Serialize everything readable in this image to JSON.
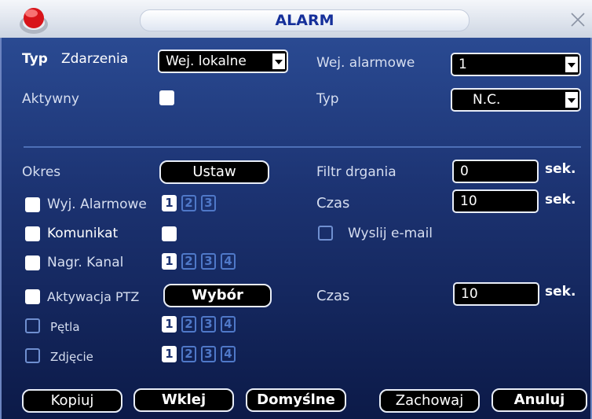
{
  "window": {
    "title": "ALARM"
  },
  "top": {
    "typ_label": "Typ",
    "zdarzenia_label": "Zdarzenia",
    "zdarzenia_value": "Wej. lokalne",
    "aktywny_label": "Aktywny",
    "wej_alarmowe_label": "Wej. alarmowe",
    "wej_alarmowe_value": "1",
    "typ2_label": "Typ",
    "typ2_value": "N.C."
  },
  "main": {
    "okres_label": "Okres",
    "ustaw_button": "Ustaw",
    "wyj_alarmowe_label": "Wyj. Alarmowe",
    "wyj_alarmowe_channels": [
      {
        "label": "1",
        "selected": true
      },
      {
        "label": "2",
        "selected": false
      },
      {
        "label": "3",
        "selected": false
      }
    ],
    "komunikat_label": "Komunikat",
    "nagr_kanal_label": "Nagr. Kanal",
    "nagr_kanal_channels": [
      {
        "label": "1",
        "selected": true
      },
      {
        "label": "2",
        "selected": false
      },
      {
        "label": "3",
        "selected": false
      },
      {
        "label": "4",
        "selected": false
      }
    ],
    "aktywacja_ptz_label": "Aktywacja PTZ",
    "wybor_button": "Wybór",
    "petla_label": "Pętla",
    "petla_channels": [
      {
        "label": "1",
        "selected": true
      },
      {
        "label": "2",
        "selected": false
      },
      {
        "label": "3",
        "selected": false
      },
      {
        "label": "4",
        "selected": false
      }
    ],
    "zdjecie_label": "Zdjęcie",
    "zdjecie_channels": [
      {
        "label": "1",
        "selected": true
      },
      {
        "label": "2",
        "selected": false
      },
      {
        "label": "3",
        "selected": false
      },
      {
        "label": "4",
        "selected": false
      }
    ],
    "filtr_label": "Filtr drgania",
    "filtr_value": "0",
    "filtr_unit": "sek.",
    "czas1_label": "Czas",
    "czas1_value": "10",
    "czas1_unit": "sek.",
    "wyslij_label": "Wyslij e-mail",
    "czas2_label": "Czas",
    "czas2_value": "10",
    "czas2_unit": "sek."
  },
  "buttons": {
    "kopiuj": "Kopiuj",
    "wklej": "Wklej",
    "domyslne": "Domyślne",
    "zachowaj": "Zachowaj",
    "anuluj": "Anuluj"
  }
}
